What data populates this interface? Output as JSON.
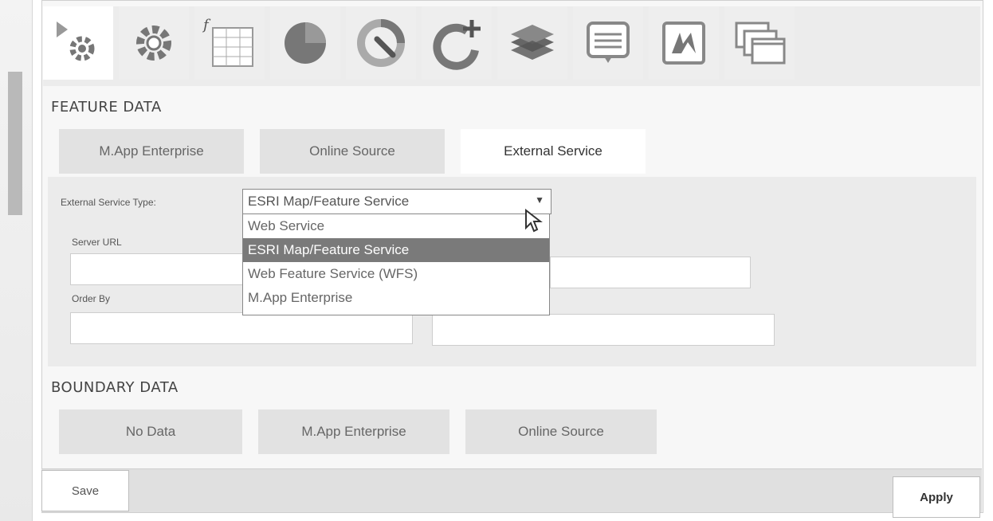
{
  "toolbar": {
    "icons": [
      "play-settings-icon",
      "gear-icon",
      "formula-table-icon",
      "pie-chart-icon",
      "wrench-chart-icon",
      "add-chart-icon",
      "layers-icon",
      "comment-icon",
      "logo-icon",
      "windows-icon"
    ]
  },
  "feature_data": {
    "title": "FEATURE DATA",
    "tabs": [
      "M.App Enterprise",
      "Online Source",
      "External Service"
    ],
    "active_tab": "External Service",
    "external_service_type_label": "External Service Type:",
    "selected_type": "ESRI Map/Feature Service",
    "options": [
      "Web Service",
      "ESRI Map/Feature Service",
      "Web Feature Service (WFS)",
      "M.App Enterprise"
    ],
    "server_url_label": "Server URL",
    "server_url_value": "",
    "order_by_label": "Order By",
    "order_by_value": ""
  },
  "boundary_data": {
    "title": "BOUNDARY DATA",
    "tabs": [
      "No Data",
      "M.App Enterprise",
      "Online Source"
    ]
  },
  "footer": {
    "save_label": "Save",
    "apply_label": "Apply"
  },
  "colors": {
    "selected_option": "#7a7a7a",
    "tab_inactive": "#e2e2e2",
    "tab_active": "#ffffff"
  }
}
